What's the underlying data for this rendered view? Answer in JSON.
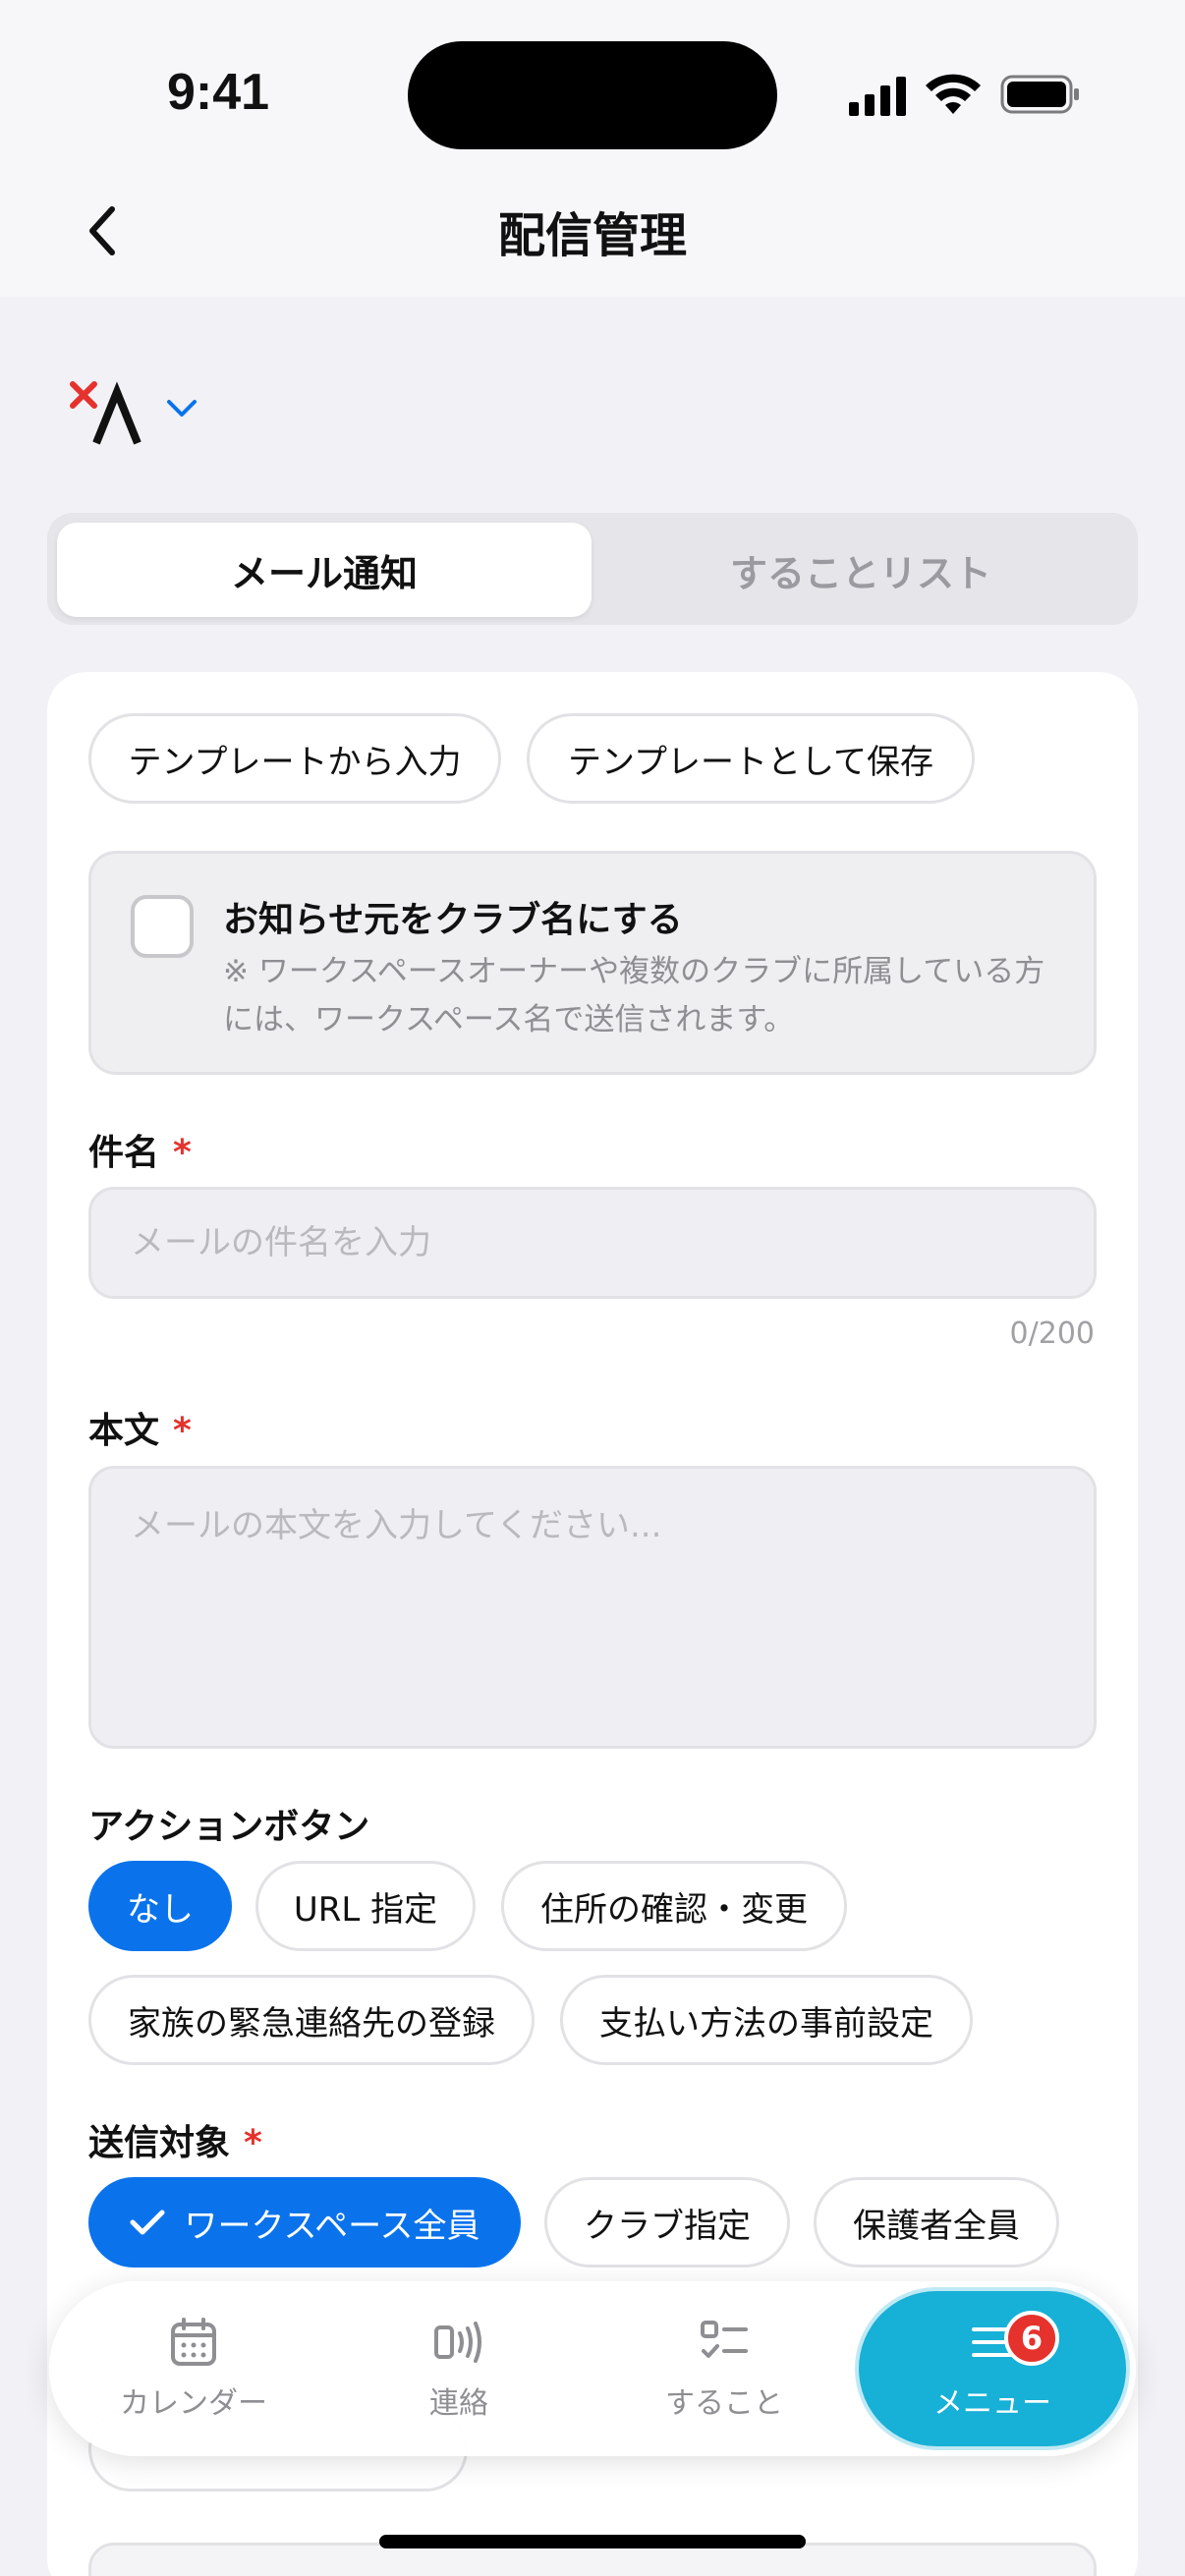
{
  "status_bar": {
    "time": "9:41"
  },
  "nav": {
    "title": "配信管理"
  },
  "segment": {
    "tab1": "メール通知",
    "tab2": "することリスト"
  },
  "templates": {
    "load": "テンプレートから入力",
    "save": "テンプレートとして保存"
  },
  "notice": {
    "title": "お知らせ元をクラブ名にする",
    "desc": "※ ワークスペースオーナーや複数のクラブに所属している方には、ワークスペース名で送信されます。"
  },
  "subject": {
    "label": "件名",
    "required": "*",
    "placeholder": "メールの件名を入力",
    "counter": "0/200"
  },
  "body": {
    "label": "本文",
    "required": "*",
    "placeholder": "メールの本文を入力してください..."
  },
  "action_button": {
    "label": "アクションボタン",
    "options": [
      "なし",
      "URL 指定",
      "住所の確認・変更",
      "家族の緊急連絡先の登録",
      "支払い方法の事前設定"
    ],
    "selected": "なし"
  },
  "target": {
    "label": "送信対象",
    "required": "*",
    "options": [
      "ワークスペース全員",
      "クラブ指定",
      "保護者全員"
    ],
    "selected": "ワークスペース全員"
  },
  "tabbar": {
    "items": [
      {
        "label": "カレンダー",
        "icon": "calendar-icon"
      },
      {
        "label": "連絡",
        "icon": "broadcast-icon"
      },
      {
        "label": "すること",
        "icon": "checklist-icon"
      },
      {
        "label": "メニュー",
        "icon": "menu-icon",
        "badge": "6"
      }
    ],
    "active": "メニュー"
  },
  "colors": {
    "accent": "#0a73ec",
    "tab_active": "#17b0d6",
    "required": "#e5322d"
  }
}
